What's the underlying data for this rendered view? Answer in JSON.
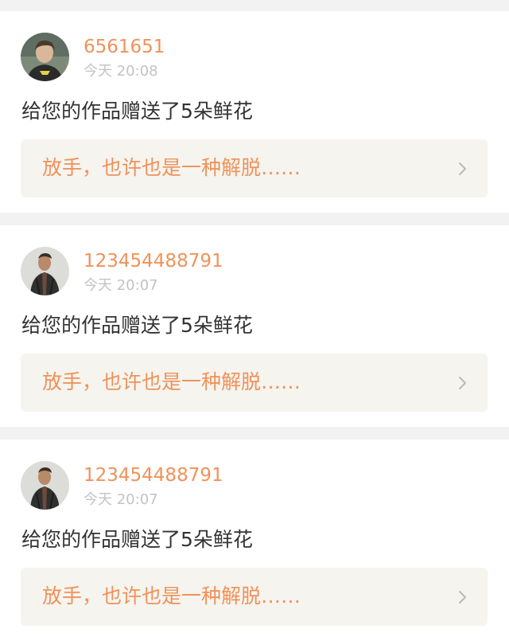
{
  "notifications": [
    {
      "username": "6561651",
      "time": "今天 20:08",
      "message": "给您的作品赠送了5朵鲜花",
      "work_title": "放手，也许也是一种解脱……",
      "avatar_icon": "boy-avatar"
    },
    {
      "username": "123454488791",
      "time": "今天 20:07",
      "message": "给您的作品赠送了5朵鲜花",
      "work_title": "放手，也许也是一种解脱……",
      "avatar_icon": "man-jacket-avatar"
    },
    {
      "username": "123454488791",
      "time": "今天 20:07",
      "message": "给您的作品赠送了5朵鲜花",
      "work_title": "放手，也许也是一种解脱……",
      "avatar_icon": "man-jacket-avatar"
    }
  ],
  "colors": {
    "accent": "#f0925a",
    "card_background": "#ffffff",
    "page_background": "#f2f2f2",
    "link_background": "#f5f4ef",
    "muted_text": "#c3c3c3",
    "body_text": "#333333"
  }
}
